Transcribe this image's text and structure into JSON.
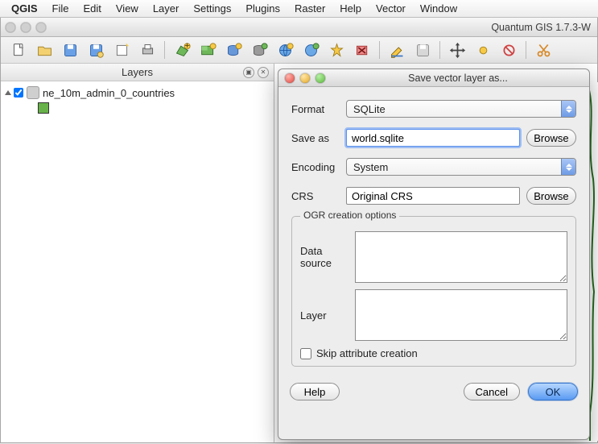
{
  "menubar": {
    "app": "QGIS",
    "items": [
      "File",
      "Edit",
      "View",
      "Layer",
      "Settings",
      "Plugins",
      "Raster",
      "Help",
      "Vector",
      "Window"
    ]
  },
  "main_window": {
    "title": "Quantum GIS 1.7.3-W"
  },
  "toolbar": {
    "icons": [
      "new-project-icon",
      "open-project-icon",
      "save-project-icon",
      "save-project-as-icon",
      "new-print-composer-icon",
      "print-icon",
      "sep",
      "add-vector-layer-icon",
      "add-raster-layer-icon",
      "add-postgis-layer-icon",
      "add-spatialite-layer-icon",
      "add-wms-layer-icon",
      "add-wfs-layer-icon",
      "new-bookmark-icon",
      "remove-layer-icon",
      "sep",
      "pencil-edit-icon",
      "save-edits-icon",
      "sep",
      "navigate-icon",
      "select-icon",
      "deselect-icon",
      "sep",
      "cut-icon"
    ]
  },
  "layers_panel": {
    "title": "Layers",
    "tree": [
      {
        "expanded": true,
        "checked": true,
        "name": "ne_10m_admin_0_countries",
        "legend_color": "#68b24a"
      }
    ]
  },
  "dialog": {
    "title": "Save vector layer as...",
    "format": {
      "label": "Format",
      "value": "SQLite"
    },
    "save_as": {
      "label": "Save as",
      "value": "world.sqlite",
      "browse": "Browse"
    },
    "encoding": {
      "label": "Encoding",
      "value": "System"
    },
    "crs": {
      "label": "CRS",
      "value": "Original CRS",
      "browse": "Browse"
    },
    "ogr_box": {
      "legend": "OGR creation options",
      "data_source_label": "Data source",
      "layer_label": "Layer",
      "skip_attr": {
        "label": "Skip attribute creation",
        "checked": false
      }
    },
    "buttons": {
      "help": "Help",
      "cancel": "Cancel",
      "ok": "OK"
    }
  }
}
